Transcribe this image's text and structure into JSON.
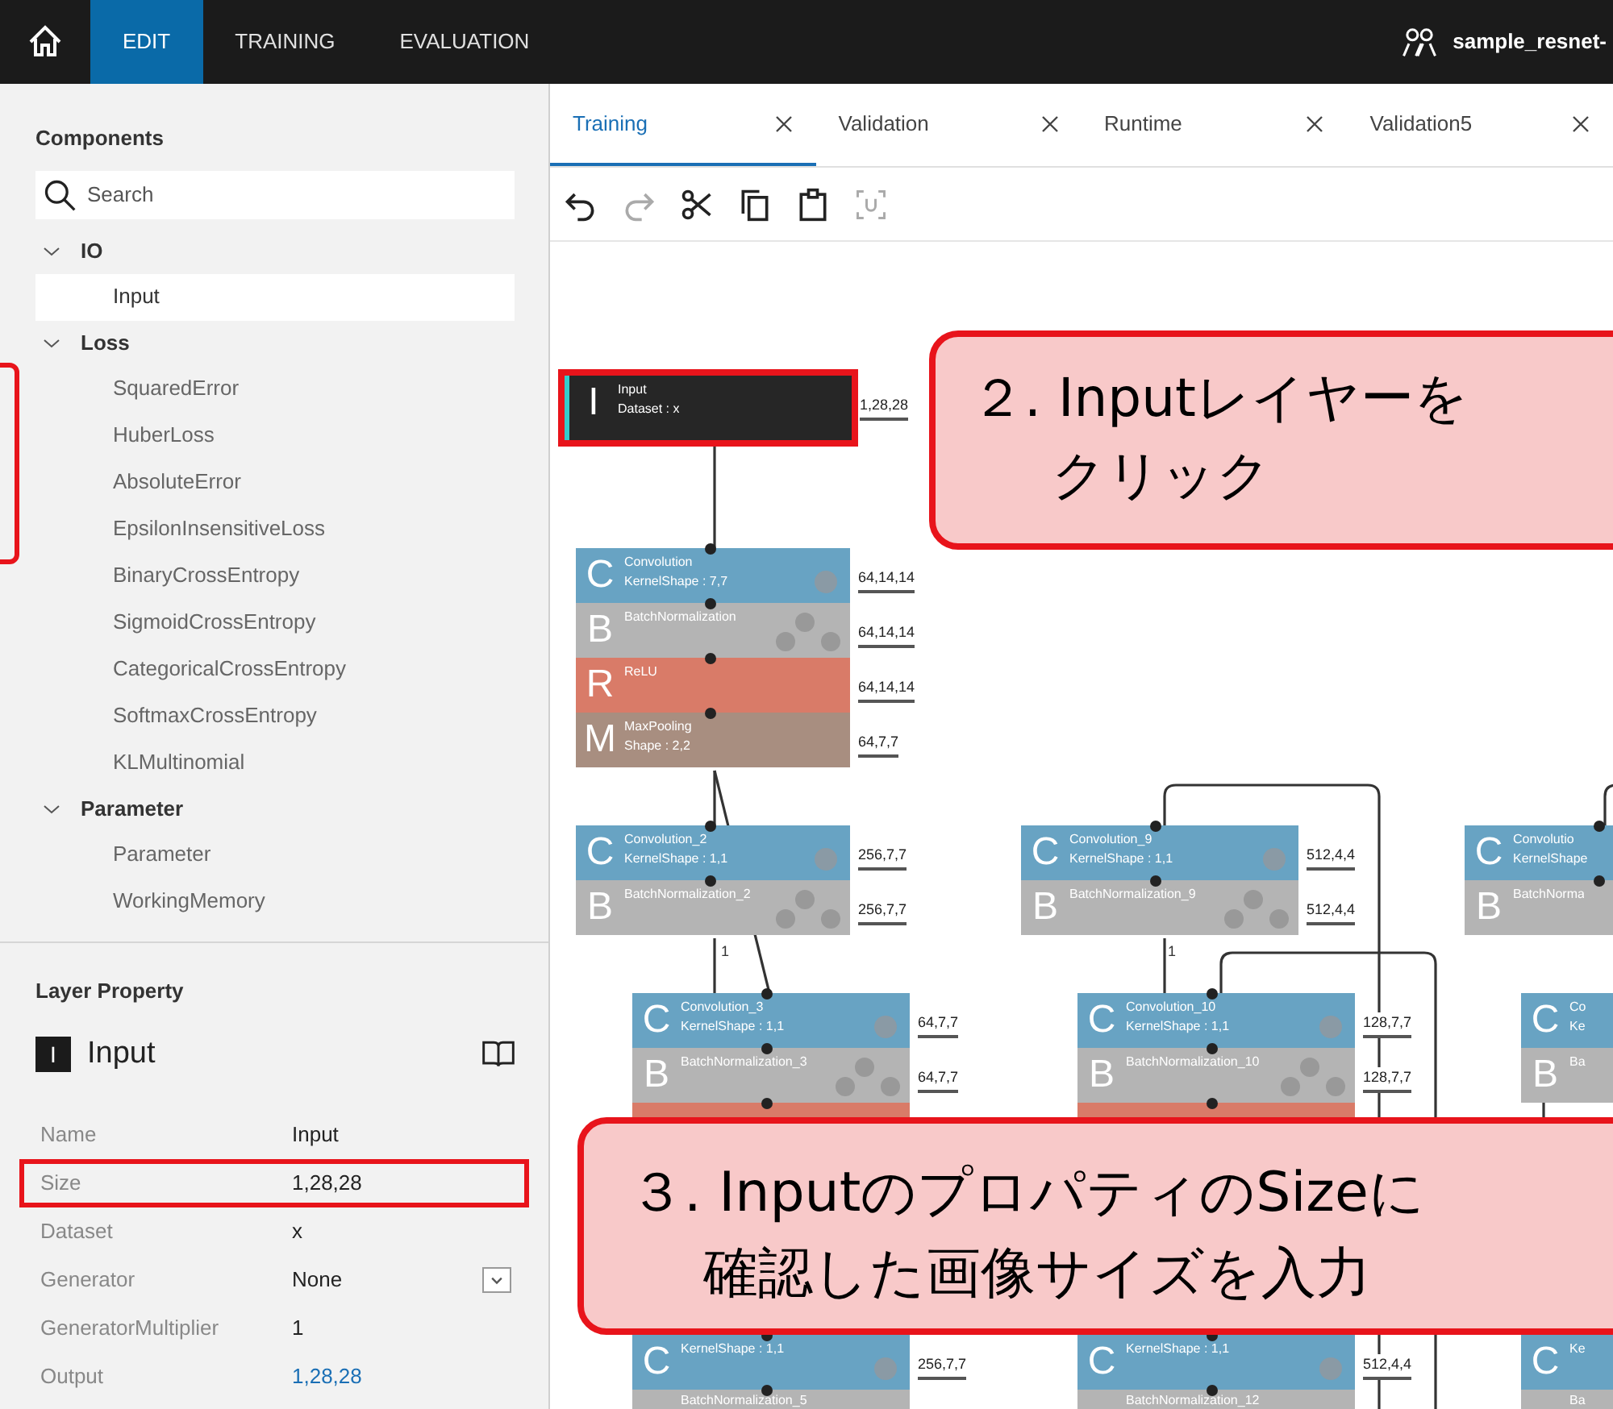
{
  "app_bar": {
    "tabs": [
      {
        "label": "EDIT",
        "selected": true
      },
      {
        "label": "TRAINING",
        "selected": false
      },
      {
        "label": "EVALUATION",
        "selected": false
      }
    ],
    "project": "sample_resnet-"
  },
  "components": {
    "title": "Components",
    "search": {
      "placeholder": "Search"
    },
    "tree": [
      {
        "label": "IO",
        "expanded": true,
        "children": [
          {
            "label": "Input",
            "selected": true
          }
        ]
      },
      {
        "label": "Loss",
        "expanded": true,
        "children": [
          {
            "label": "SquaredError",
            "selected": false
          },
          {
            "label": "HuberLoss",
            "selected": false
          },
          {
            "label": "AbsoluteError",
            "selected": false
          },
          {
            "label": "EpsilonInsensitiveLoss",
            "selected": false
          },
          {
            "label": "BinaryCrossEntropy",
            "selected": false
          },
          {
            "label": "SigmoidCrossEntropy",
            "selected": false
          },
          {
            "label": "CategoricalCrossEntropy",
            "selected": false
          },
          {
            "label": "SoftmaxCrossEntropy",
            "selected": false
          },
          {
            "label": "KLMultinomial",
            "selected": false
          }
        ]
      },
      {
        "label": "Parameter",
        "expanded": true,
        "children": [
          {
            "label": "Parameter",
            "selected": false
          },
          {
            "label": "WorkingMemory",
            "selected": false
          }
        ]
      }
    ],
    "edge_frame": true
  },
  "layer_property": {
    "title": "Layer Property",
    "layer": {
      "letter": "I",
      "name": "Input"
    },
    "rows": [
      {
        "name": "Name",
        "value": "Input",
        "kind": "text",
        "highlighted": false
      },
      {
        "name": "Size",
        "value": "1,28,28",
        "kind": "text",
        "highlighted": true
      },
      {
        "name": "Dataset",
        "value": "x",
        "kind": "text",
        "highlighted": false
      },
      {
        "name": "Generator",
        "value": "None",
        "kind": "dropdown",
        "highlighted": false
      },
      {
        "name": "GeneratorMultiplier",
        "value": "1",
        "kind": "text",
        "highlighted": false
      },
      {
        "name": "Output",
        "value": "1,28,28",
        "kind": "link",
        "highlighted": false
      }
    ]
  },
  "editor": {
    "tabs": [
      {
        "label": "Training",
        "selected": true
      },
      {
        "label": "Validation",
        "selected": false
      },
      {
        "label": "Runtime",
        "selected": false
      },
      {
        "label": "Validation5",
        "selected": false
      }
    ],
    "toolbar": [
      {
        "kind": "undo",
        "disabled": false
      },
      {
        "kind": "redo",
        "disabled": true
      },
      {
        "kind": "cut",
        "disabled": false
      },
      {
        "kind": "copy",
        "disabled": false
      },
      {
        "kind": "paste",
        "disabled": false
      },
      {
        "kind": "unit",
        "disabled": true
      }
    ],
    "nodes": [
      {
        "selected": true,
        "layers": [
          {
            "kind": "input",
            "letter": "I",
            "title": "Input",
            "param": "Dataset : x",
            "output": "1,28,28"
          }
        ]
      },
      {
        "selected": false,
        "layers": [
          {
            "kind": "convolution",
            "letter": "C",
            "title": "Convolution",
            "param": "KernelShape : 7,7",
            "output": "64,14,14"
          },
          {
            "kind": "batchnorm",
            "letter": "B",
            "title": "BatchNormalization",
            "output": "64,14,14"
          },
          {
            "kind": "relu",
            "letter": "R",
            "title": "ReLU",
            "output": "64,14,14"
          },
          {
            "kind": "maxpool",
            "letter": "M",
            "title": "MaxPooling",
            "param": "Shape : 2,2",
            "output": "64,7,7"
          }
        ]
      },
      {
        "selected": false,
        "edge_label": "1",
        "layers": [
          {
            "kind": "convolution",
            "letter": "C",
            "title": "Convolution_2",
            "param": "KernelShape : 1,1",
            "output": "256,7,7"
          },
          {
            "kind": "batchnorm",
            "letter": "B",
            "title": "BatchNormalization_2",
            "output": "256,7,7"
          }
        ]
      },
      {
        "selected": false,
        "layers": [
          {
            "kind": "convolution",
            "letter": "C",
            "title": "Convolution_3",
            "param": "KernelShape : 1,1",
            "output": "64,7,7"
          },
          {
            "kind": "batchnorm",
            "letter": "B",
            "title": "BatchNormalization_3",
            "output": "64,7,7"
          },
          {
            "kind": "relu"
          }
        ]
      },
      {
        "selected": false,
        "edge_label": "1",
        "layers": [
          {
            "kind": "convolution",
            "letter": "C",
            "title": "Convolution_9",
            "param": "KernelShape : 1,1",
            "output": "512,4,4"
          },
          {
            "kind": "batchnorm",
            "letter": "B",
            "title": "BatchNormalization_9",
            "output": "512,4,4"
          }
        ]
      },
      {
        "selected": false,
        "layers": [
          {
            "kind": "convolution",
            "letter": "C",
            "title": "Convolution_10",
            "param": "KernelShape : 1,1",
            "output": "128,7,7"
          },
          {
            "kind": "batchnorm",
            "letter": "B",
            "title": "BatchNormalization_10",
            "output": "128,7,7"
          },
          {
            "kind": "relu"
          }
        ]
      },
      {
        "selected": false,
        "layers": [
          {
            "kind": "convolution",
            "letter": "C",
            "title": "Convolutio",
            "param": "KernelShape"
          },
          {
            "kind": "batchnorm",
            "letter": "B",
            "title": "BatchNorma"
          }
        ]
      },
      {
        "selected": false,
        "layers": [
          {
            "kind": "convolution",
            "letter": "C",
            "title": "Co",
            "param": "Ke"
          },
          {
            "kind": "batchnorm",
            "letter": "B",
            "title": "Ba"
          }
        ]
      },
      {
        "selected": false,
        "layers": [
          {
            "kind": "convolution",
            "letter": "C",
            "param": "KernelShape : 1,1",
            "output": "256,7,7"
          },
          {
            "kind": "batchnorm",
            "title": "BatchNormalization_5"
          }
        ]
      },
      {
        "selected": false,
        "layers": [
          {
            "kind": "convolution",
            "letter": "C",
            "param": "KernelShape : 1,1",
            "output": "512,4,4"
          },
          {
            "kind": "batchnorm",
            "title": "BatchNormalization_12"
          }
        ]
      },
      {
        "selected": false,
        "layers": [
          {
            "kind": "convolution",
            "letter": "C",
            "param": "Ke"
          },
          {
            "kind": "batchnorm",
            "title": "Ba"
          }
        ]
      }
    ]
  },
  "annotations": [
    {
      "lines": [
        "２. Inputレイヤーを",
        "クリック"
      ]
    },
    {
      "lines": [
        "３. InputのプロパティのSizeに",
        "確認した画像サイズを入力"
      ]
    }
  ]
}
